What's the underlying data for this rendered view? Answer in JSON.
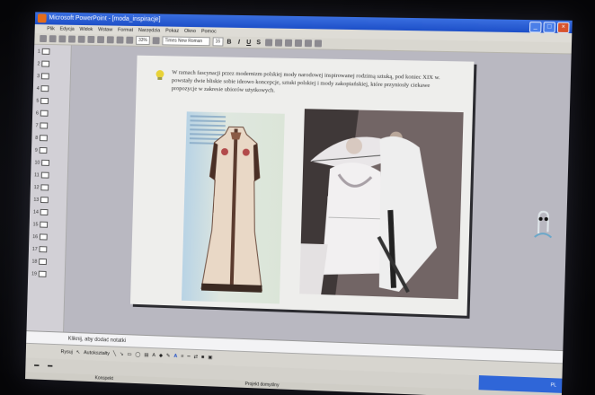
{
  "window": {
    "title": "Microsoft PowerPoint - [moda_inspiracje]"
  },
  "menu": [
    "Plik",
    "Edycja",
    "Widok",
    "Wstaw",
    "Format",
    "Narzędzia",
    "Pokaz",
    "Okno",
    "Pomoc"
  ],
  "toolbar": {
    "zoom": "33%",
    "font": "Times New Roman",
    "size": "16"
  },
  "slides": [
    "1",
    "2",
    "3",
    "4",
    "5",
    "6",
    "7",
    "8",
    "9",
    "10",
    "11",
    "12",
    "13",
    "14",
    "15",
    "16",
    "17",
    "18",
    "19"
  ],
  "slide": {
    "text": "W ramach fascynacji przez modernizm polskiej mody narodowej inspirowanej rodzimą sztuką, pod koniec XIX w. powstały dwie bliskie sobie ideowo koncepcje, sztuki polskiej i mody zakopiańskiej, które przyniosły ciekawe propozycje w zakresie ubiorów użytkowych."
  },
  "notes": {
    "placeholder": "Kliknij, aby dodać notatki"
  },
  "drawbar": {
    "draw": "Rysuj",
    "autoshapes": "Autokształty"
  },
  "status": {
    "left": "Konspekt",
    "center": "Projekt domyślny",
    "right": "PL"
  },
  "colors": {
    "titlebar": "#2a5fd6",
    "slide_bg": "#eeeeec",
    "workspace": "#b9b8c1"
  }
}
